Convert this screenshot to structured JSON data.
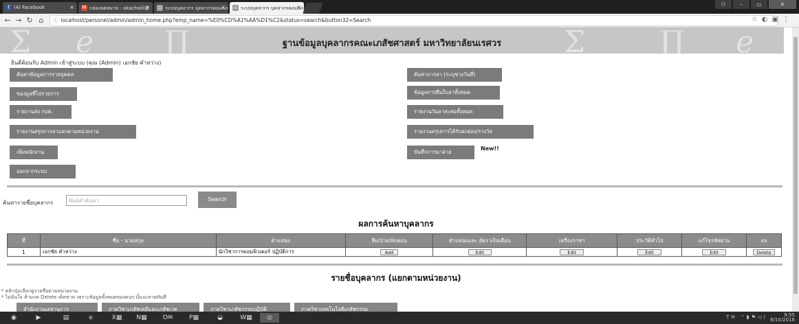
{
  "browser": {
    "tabs": [
      {
        "label": "(4) Facebook",
        "icon": "facebook-icon",
        "color": "#3b5998"
      },
      {
        "label": "กล่องจดหมาย - akachaiil@",
        "icon": "gmail-icon",
        "color": "#d44638"
      },
      {
        "label": "ระบบบุคลากร บุคลากรคณะเภ",
        "icon": "page-icon",
        "color": "#9a9a9a"
      },
      {
        "label": "ระบบบุคลากร บุคลากรคณะเภ",
        "icon": "page-icon",
        "color": "#9a9a9a"
      }
    ],
    "url": "localhost/personel/admin/admin_home.php?emp_name=%E0%CD%A1%AA%D1%C2&status=search&button32=Search"
  },
  "header": {
    "title": "ฐานข้อมูลบุคลากรคณะเภสัชศาสตร์ มหาวิทยาลัยนเรศวร",
    "welcome": "ยินดีต้อนรับ Admin เข้าสู่ระบบ (คุณ (Admin) เอกชัย คำหว่าง)"
  },
  "menu_left": [
    "ค้นหาข้อมูลการรายบุคคล",
    "ของมูลที่ไปรายการ",
    "รายงานส่ง กบค.",
    "รายงานสรุปการลาแยกตามหน่วยงาน",
    "เพิ่มพนักงาน",
    "ออกจากระบบ"
  ],
  "menu_right": [
    "ค้นหาการลา (ระบุช่วงวันที่)",
    "ข้อมูลการยื่นใบลาทั้งหมด",
    "รายงานวันลาสะสมทั้งหมด",
    "รายงานสรุปการได้รับยกย่อง/รางวัล",
    "บันทึกการมาสาย"
  ],
  "new_badge": "New!!",
  "search": {
    "label": "ค้นหารายชื่อบุคลากร",
    "placeholder": "พิมพ์คำค้นหา",
    "button": "Search"
  },
  "results": {
    "title": "ผลการค้นหาบุคลากร",
    "columns": [
      "ที่",
      "ชื่อ - นามสกุล",
      "ตำแหน่ง",
      "ลืม/ป่วย/พักผ่อน",
      "ตำแหน่งและ อัตราเงินเดือน",
      "เครื่องราชฯ",
      "ประวัติทั่วไป",
      "แก้ไขรหัสผ่าน",
      "ลบ"
    ],
    "rows": [
      {
        "no": "1",
        "name": "เอกชัย คำหว่าง",
        "position": "นักวิชาการคอมพิวเตอร์ ปฏิบัติการ",
        "b1": "Add",
        "b2": "Edit",
        "b3": "Edit",
        "b4": "Edit",
        "b5": "Edit",
        "b6": "Delete"
      }
    ]
  },
  "staff": {
    "title": "รายชื่อบุคลากร (แยกตามหน่วยงาน)",
    "notes": [
      "* คลิกปุ่มเลือกดูรายชื่อตามหน่วยงาน",
      "* ไม่มั่นใจ ห้ามกด Delete เด็ดขาด เพราะข้อมูลทั้งหมดของคนๆ นั้นจะหายทันที"
    ],
    "departments": [
      "สำนักงานเลขานุการ",
      "ภาควิชาเภสัชเคมีและเภสัชเวท",
      "ภาควิชาเภสัชกรรมปฏิบัติ",
      "ภาควิชาเทคโนโลยีเภสัชกรรม"
    ]
  },
  "taskbar": {
    "tray_lang": "TH",
    "clock_time": "9:55",
    "clock_date": "6/10/2016"
  }
}
